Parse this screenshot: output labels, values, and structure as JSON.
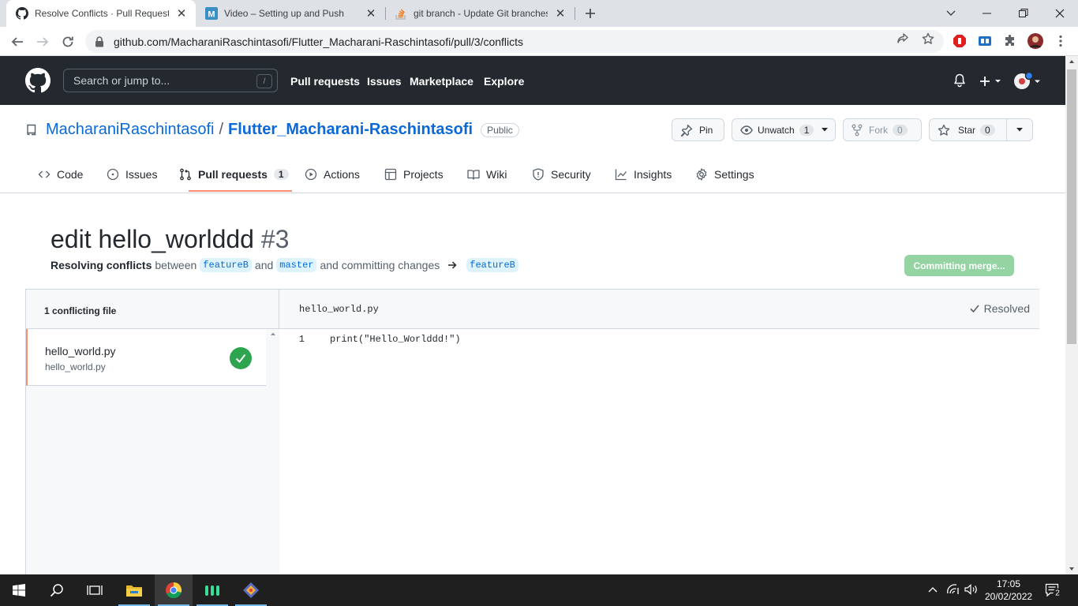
{
  "browser": {
    "tabs": [
      {
        "title": "Resolve Conflicts · Pull Request #",
        "icon": "github-icon",
        "active": true
      },
      {
        "title": "Video – Setting up and Push",
        "icon": "medium-icon",
        "active": false
      },
      {
        "title": "git branch - Update Git branches",
        "icon": "stackoverflow-icon",
        "active": false
      }
    ],
    "url": "github.com/MacharaniRaschintasofi/Flutter_Macharani-Raschintasofi/pull/3/conflicts"
  },
  "gh_header": {
    "search_placeholder": "Search or jump to...",
    "search_shortcut": "/",
    "nav": [
      "Pull requests",
      "Issues",
      "Marketplace",
      "Explore"
    ]
  },
  "repo": {
    "owner": "MacharaniRaschintasofi",
    "separator": "/",
    "name": "Flutter_Macharani-Raschintasofi",
    "visibility": "Public",
    "pin_label": "Pin",
    "watch_label": "Unwatch",
    "watch_count": "1",
    "fork_label": "Fork",
    "fork_count": "0",
    "star_label": "Star",
    "star_count": "0",
    "tabs": [
      {
        "label": "Code"
      },
      {
        "label": "Issues"
      },
      {
        "label": "Pull requests",
        "count": "1",
        "selected": true
      },
      {
        "label": "Actions"
      },
      {
        "label": "Projects"
      },
      {
        "label": "Wiki"
      },
      {
        "label": "Security"
      },
      {
        "label": "Insights"
      },
      {
        "label": "Settings"
      }
    ]
  },
  "pr": {
    "title": "edit hello_worlddd",
    "number": "#3",
    "sub_bold": "Resolving conflicts",
    "sub_between": "between",
    "head_branch": "featureB",
    "sub_and": "and",
    "base_branch": "master",
    "sub_committing": "and committing changes",
    "target_branch": "featureB",
    "commit_button": "Committing merge..."
  },
  "conflicts": {
    "header": "1 conflicting file",
    "files": [
      {
        "name": "hello_world.py",
        "path": "hello_world.py"
      }
    ],
    "current_file": "hello_world.py",
    "resolved_label": "Resolved",
    "lines": [
      {
        "number": "1",
        "text": "print(\"Hello_Worlddd!\")"
      }
    ]
  },
  "taskbar": {
    "time": "17:05",
    "date": "20/02/2022",
    "notification_count": "2"
  },
  "colors": {
    "gh_header_bg": "#24292f",
    "link_blue": "#0969da",
    "tab_underline": "#fd8c73",
    "success_green": "#2da44e",
    "disabled_green": "#94d3a2"
  }
}
